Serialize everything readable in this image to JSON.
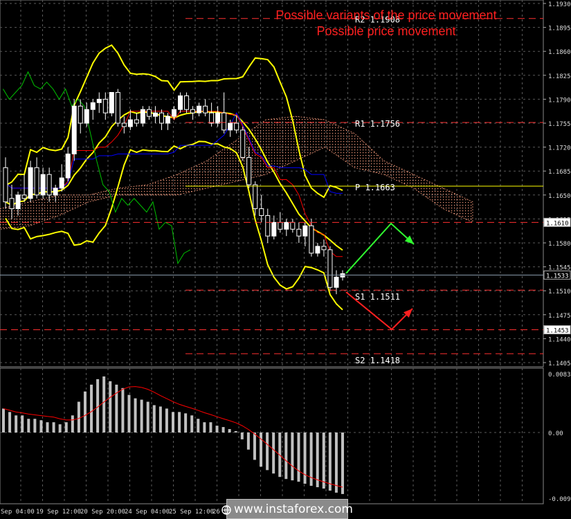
{
  "annotations": {
    "line1": "Possible variants of the price movement",
    "line2": "Possible price movement",
    "color": "#ff2020"
  },
  "watermark": "www.instaforex.com",
  "colors": {
    "background": "#000000",
    "grid": "#5a5a5a",
    "bull_candle": "#ffffff",
    "bear_candle": "#ffffff",
    "bollinger": "#ffff00",
    "tenkan": "#ff0000",
    "kijun": "#0000ff",
    "chikou": "#00c000",
    "kumo": "#ffa080",
    "pivot": "#ffff00",
    "res_sup": "#ff3030",
    "macd_hist": "#c0c0c0",
    "macd_signal": "#ff0000",
    "arrow_up": "#30ff30",
    "arrow_down": "#ff2020"
  },
  "chart_data": [
    {
      "type": "candlestick",
      "pane": "price",
      "ylim": [
        1.4025,
        1.193
      ],
      "y_ticks": [
        "1.1930",
        "1.1895",
        "1.1860",
        "1.1825",
        "1.1790",
        "1.1755",
        "1.1720",
        "1.1685",
        "1.1650",
        "1.1615",
        "1.1580",
        "1.1545",
        "1.1510",
        "1.1475",
        "1.1440",
        "1.1405"
      ],
      "x_ticks": [
        "Sep 04:00",
        "19 Sep 12:00",
        "20 Sep 20:00",
        "24 Sep 04:00",
        "25 Sep 12:00",
        "26 Se"
      ],
      "levels": [
        {
          "label": "R2",
          "value": 1.1908,
          "style": "dashed"
        },
        {
          "label": "R1",
          "value": 1.1756,
          "style": "dashed"
        },
        {
          "label": "P",
          "value": 1.1663,
          "style": "solid"
        },
        {
          "label": "S1",
          "value": 1.1511,
          "style": "dashed"
        },
        {
          "label": "S2",
          "value": 1.1418,
          "style": "dashed"
        }
      ],
      "price_marks": [
        {
          "value": "1.1610",
          "y": 1.161
        },
        {
          "value": "1.1533",
          "y": 1.1533
        },
        {
          "value": "1.1453",
          "y": 1.1453
        }
      ],
      "candles": [
        [
          1.169,
          1.1705,
          1.163,
          1.164
        ],
        [
          1.1645,
          1.1665,
          1.1615,
          1.163
        ],
        [
          1.163,
          1.1655,
          1.162,
          1.165
        ],
        [
          1.165,
          1.168,
          1.164,
          1.1645
        ],
        [
          1.1645,
          1.17,
          1.164,
          1.169
        ],
        [
          1.169,
          1.1705,
          1.1645,
          1.165
        ],
        [
          1.165,
          1.169,
          1.1645,
          1.168
        ],
        [
          1.168,
          1.169,
          1.164,
          1.165
        ],
        [
          1.165,
          1.1665,
          1.164,
          1.166
        ],
        [
          1.166,
          1.1695,
          1.1655,
          1.1675
        ],
        [
          1.1675,
          1.172,
          1.167,
          1.171
        ],
        [
          1.171,
          1.179,
          1.17,
          1.178
        ],
        [
          1.178,
          1.179,
          1.174,
          1.1755
        ],
        [
          1.1755,
          1.1785,
          1.175,
          1.1775
        ],
        [
          1.1775,
          1.179,
          1.176,
          1.1785
        ],
        [
          1.1785,
          1.18,
          1.177,
          1.179
        ],
        [
          1.179,
          1.18,
          1.176,
          1.177
        ],
        [
          1.177,
          1.18,
          1.1765,
          1.18
        ],
        [
          1.18,
          1.1805,
          1.175,
          1.1755
        ],
        [
          1.1755,
          1.1765,
          1.174,
          1.175
        ],
        [
          1.175,
          1.1775,
          1.1745,
          1.176
        ],
        [
          1.176,
          1.177,
          1.175,
          1.1755
        ],
        [
          1.1755,
          1.178,
          1.175,
          1.1775
        ],
        [
          1.1775,
          1.178,
          1.176,
          1.1765
        ],
        [
          1.1765,
          1.178,
          1.1755,
          1.177
        ],
        [
          1.177,
          1.1775,
          1.1745,
          1.1755
        ],
        [
          1.1755,
          1.177,
          1.1745,
          1.1765
        ],
        [
          1.1765,
          1.178,
          1.176,
          1.1775
        ],
        [
          1.1775,
          1.18,
          1.177,
          1.1795
        ],
        [
          1.1795,
          1.18,
          1.177,
          1.1775
        ],
        [
          1.1775,
          1.178,
          1.176,
          1.177
        ],
        [
          1.177,
          1.1785,
          1.1765,
          1.178
        ],
        [
          1.178,
          1.179,
          1.1765,
          1.177
        ],
        [
          1.177,
          1.1785,
          1.175,
          1.1755
        ],
        [
          1.1755,
          1.178,
          1.175,
          1.177
        ],
        [
          1.177,
          1.18,
          1.174,
          1.1745
        ],
        [
          1.1745,
          1.176,
          1.1735,
          1.1755
        ],
        [
          1.1755,
          1.1765,
          1.174,
          1.1745
        ],
        [
          1.1745,
          1.175,
          1.17,
          1.1705
        ],
        [
          1.1705,
          1.172,
          1.166,
          1.1665
        ],
        [
          1.1665,
          1.167,
          1.162,
          1.163
        ],
        [
          1.163,
          1.165,
          1.161,
          1.162
        ],
        [
          1.162,
          1.163,
          1.158,
          1.159
        ],
        [
          1.159,
          1.162,
          1.1585,
          1.161
        ],
        [
          1.161,
          1.1625,
          1.1595,
          1.16
        ],
        [
          1.16,
          1.1615,
          1.159,
          1.161
        ],
        [
          1.161,
          1.1615,
          1.1595,
          1.16
        ],
        [
          1.16,
          1.161,
          1.158,
          1.159
        ],
        [
          1.159,
          1.161,
          1.1575,
          1.1605
        ],
        [
          1.1605,
          1.1615,
          1.156,
          1.1565
        ],
        [
          1.1565,
          1.158,
          1.156,
          1.1575
        ],
        [
          1.1575,
          1.1585,
          1.156,
          1.157
        ],
        [
          1.157,
          1.1575,
          1.151,
          1.1515
        ],
        [
          1.1515,
          1.154,
          1.1505,
          1.153
        ],
        [
          1.153,
          1.154,
          1.1525,
          1.1535
        ]
      ],
      "cloud_band": {
        "top": [
          1.163,
          1.164,
          1.165,
          1.165,
          1.166,
          1.1665,
          1.168,
          1.17,
          1.173,
          1.176,
          1.1765,
          1.176,
          1.174,
          1.17,
          1.168,
          1.166,
          1.164
        ],
        "bottom": [
          1.16,
          1.1605,
          1.162,
          1.164,
          1.165,
          1.165,
          1.165,
          1.166,
          1.167,
          1.168,
          1.17,
          1.172,
          1.169,
          1.168,
          1.166,
          1.163,
          1.161
        ]
      }
    },
    {
      "type": "bar",
      "pane": "macd",
      "ylim": [
        -0.00962,
        0.0083
      ],
      "y_ticks": [
        "0.0083",
        "0.00",
        "-0.00962"
      ],
      "values": [
        0.0035,
        0.003,
        0.0025,
        0.0025,
        0.002,
        0.002,
        0.0018,
        0.0015,
        0.0015,
        0.0012,
        0.0015,
        0.0025,
        0.0045,
        0.006,
        0.007,
        0.0078,
        0.0082,
        0.0075,
        0.007,
        0.0065,
        0.0055,
        0.005,
        0.0048,
        0.0045,
        0.004,
        0.0038,
        0.0035,
        0.003,
        0.003,
        0.0028,
        0.0025,
        0.002,
        0.0015,
        0.0015,
        0.001,
        0.0008,
        0.0005,
        0.0002,
        -0.001,
        -0.0025,
        -0.004,
        -0.005,
        -0.0055,
        -0.006,
        -0.0065,
        -0.0068,
        -0.007,
        -0.0072,
        -0.0075,
        -0.0078,
        -0.008,
        -0.0082,
        -0.0085,
        -0.0088,
        -0.009
      ]
    }
  ]
}
